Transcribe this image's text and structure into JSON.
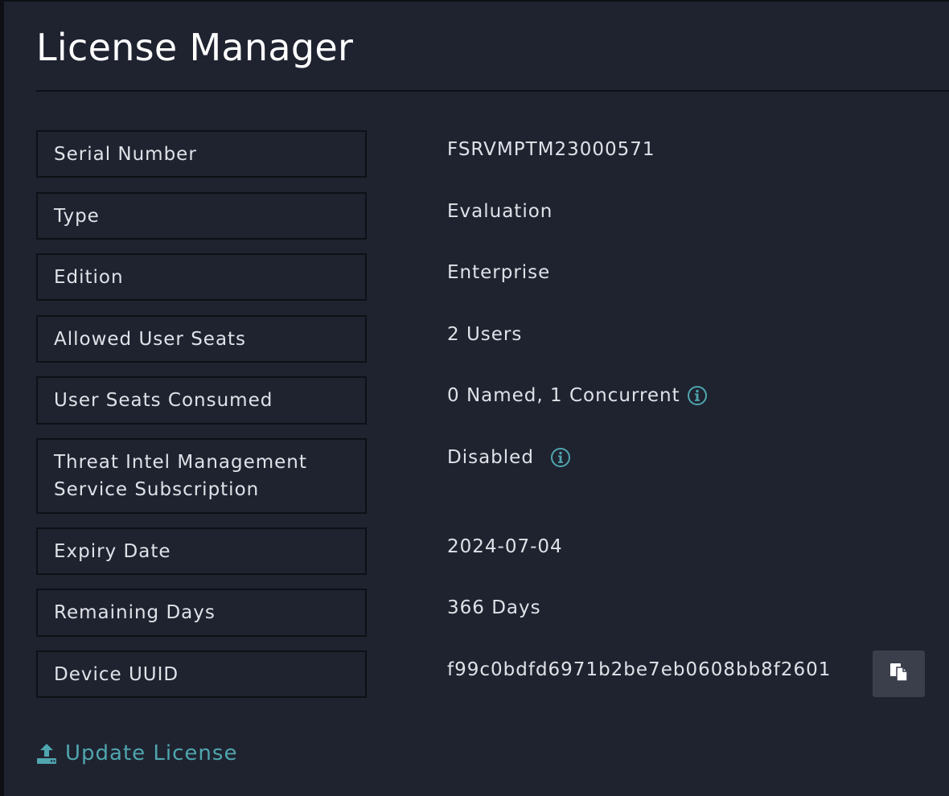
{
  "page": {
    "title": "License Manager"
  },
  "fields": [
    {
      "label": "Serial Number",
      "value": "FSRVMPTM23000571"
    },
    {
      "label": "Type",
      "value": "Evaluation"
    },
    {
      "label": "Edition",
      "value": "Enterprise"
    },
    {
      "label": "Allowed User Seats",
      "value": "2 Users"
    },
    {
      "label": "User Seats Consumed",
      "value": "0 Named, 1 Concurrent",
      "icon": "info-icon"
    },
    {
      "label_lines": [
        "Threat Intel Management",
        "Service Subscription"
      ],
      "value": "Disabled",
      "icon": "info-icon"
    },
    {
      "label": "Expiry Date",
      "value": "2024-07-04"
    },
    {
      "label": "Remaining Days",
      "value": "366 Days"
    },
    {
      "label": "Device UUID",
      "value": "f99c0bdfd6971b2be7eb0608bb8f2601",
      "action_icon": "copy-icon"
    }
  ],
  "actions": {
    "update_license_label": "Update License",
    "update_license_icon": "upload-icon"
  },
  "colors": {
    "background": "#1f2330",
    "border": "#0e1016",
    "text": "#dfe2e7",
    "accent": "#4fa6ae",
    "button": "#3a3f4b"
  }
}
